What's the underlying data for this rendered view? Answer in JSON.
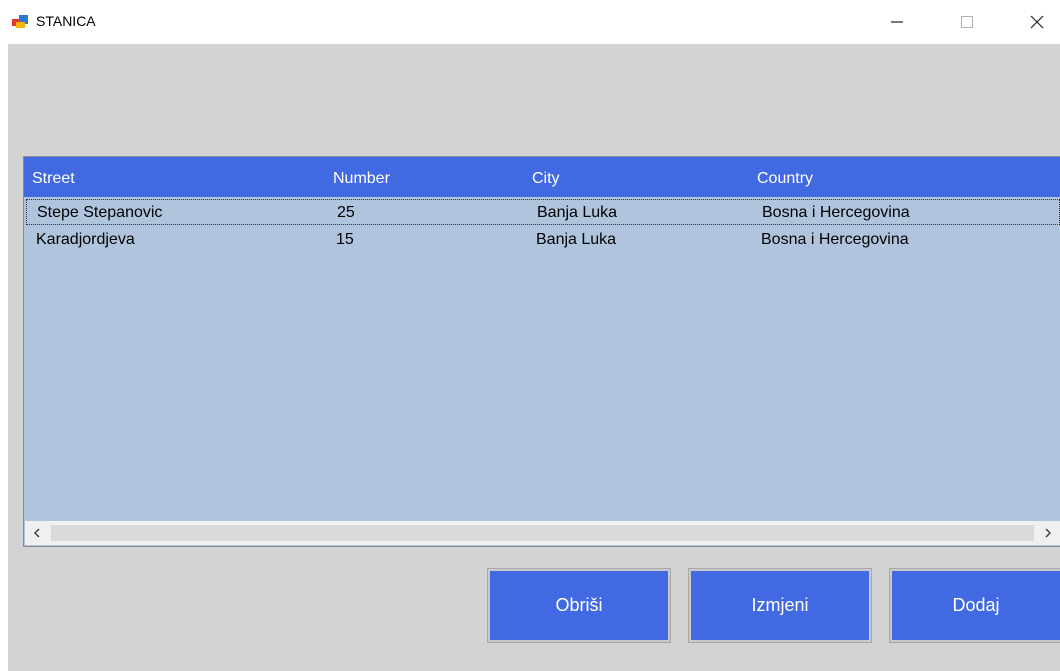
{
  "window": {
    "title": "STANICA",
    "controls": [
      "minimize",
      "maximize",
      "close"
    ]
  },
  "table": {
    "columns": [
      "Street",
      "Number",
      "City",
      "Country"
    ],
    "rows": [
      {
        "street": "Stepe Stepanovic",
        "number": "25",
        "city": "Banja Luka",
        "country": "Bosna i Hercegovina"
      },
      {
        "street": "Karadjordjeva",
        "number": "15",
        "city": "Banja Luka",
        "country": "Bosna i Hercegovina"
      }
    ]
  },
  "buttons": {
    "delete": "Obriši",
    "edit": "Izmjeni",
    "add": "Dodaj"
  },
  "colors": {
    "header_bg": "#4169e1",
    "list_bg": "#b0c4de",
    "form_bg": "#d3d3d3",
    "button_bg": "#4169e1"
  }
}
